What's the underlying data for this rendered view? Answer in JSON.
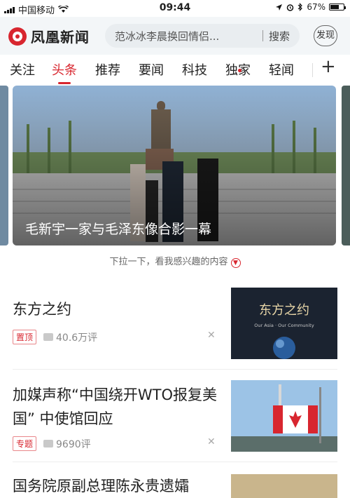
{
  "status": {
    "carrier": "中国移动",
    "time": "09:44",
    "battery": "67%",
    "battery_level": 0.67
  },
  "header": {
    "brand": "凤凰新闻",
    "search_placeholder": "范冰冰李晨换回情侣...",
    "search_button": "搜索",
    "discover": "发现"
  },
  "tabs": [
    "关注",
    "头条",
    "推荐",
    "要闻",
    "科技",
    "独家",
    "轻闻"
  ],
  "active_tab": "头条",
  "hero": {
    "caption": "毛新宇一家与毛泽东像合影一幕"
  },
  "pull_hint": "下拉一下，看我感兴趣的内容",
  "feed": [
    {
      "title": "东方之约",
      "badge": "置顶",
      "comments": "40.6万评",
      "thumb_text_cn": "东方之约",
      "thumb_text_en": "Our Asia · Our Community"
    },
    {
      "title": "加媒声称“中国绕开WTO报复美国” 中使馆回应",
      "badge": "专题",
      "comments": "9690评"
    },
    {
      "title": "国务院原副总理陈永贵遗孀"
    }
  ]
}
